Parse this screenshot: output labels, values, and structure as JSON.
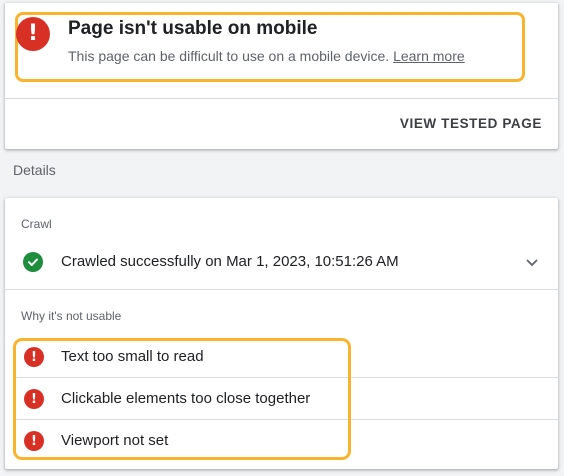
{
  "headline": {
    "title": "Page isn't usable on mobile",
    "subtitle": "This page can be difficult to use on a mobile device.",
    "learn_more": "Learn more",
    "icon": "error-icon"
  },
  "actions": {
    "view_tested_page": "VIEW TESTED PAGE"
  },
  "details": {
    "label": "Details",
    "crawl": {
      "label": "Crawl",
      "status": "Crawled successfully on Mar 1, 2023, 10:51:26 AM",
      "icon": "check-circle-icon"
    },
    "why": {
      "label": "Why it's not usable",
      "issues": [
        "Text too small to read",
        "Clickable elements too close together",
        "Viewport not set"
      ]
    }
  },
  "colors": {
    "error": "#d93025",
    "success": "#1e8e3e",
    "highlight": "#f9b42d"
  }
}
